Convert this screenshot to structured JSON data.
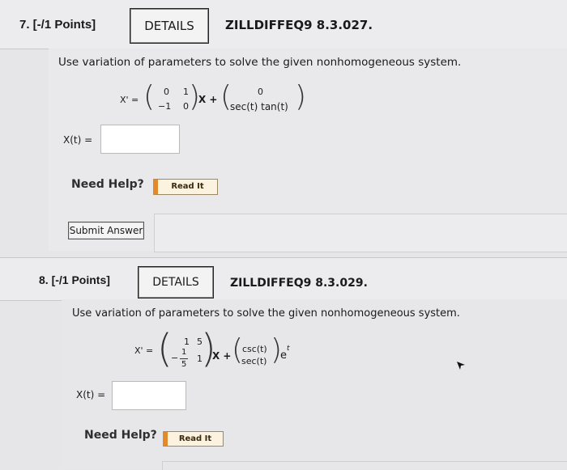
{
  "q7": {
    "number_points": "7.  [-/1 Points]",
    "details": "DETAILS",
    "code": "ZILLDIFFEQ9 8.3.027.",
    "prompt": "Use variation of parameters to solve the given nonhomogeneous system.",
    "lhs": "X' =",
    "matrix": [
      [
        "0",
        "1"
      ],
      [
        "−1",
        "0"
      ]
    ],
    "plus_x": "X +",
    "vector": [
      "0",
      "sec(t) tan(t)"
    ],
    "answer_label": "X(t) =",
    "answer_value": "",
    "need_help": "Need Help?",
    "read_it": "Read It",
    "submit": "Submit Answer"
  },
  "q8": {
    "number_points": "8.  [-/1 Points]",
    "details": "DETAILS",
    "code": "ZILLDIFFEQ9 8.3.029.",
    "prompt": "Use variation of parameters to solve the given nonhomogeneous system.",
    "lhs": "X' =",
    "matrix": {
      "r1c1": "1",
      "r1c2": "5",
      "r2c1_sign": "−",
      "r2c1_num": "1",
      "r2c1_den": "5",
      "r2c2": "1"
    },
    "plus_x": "X +",
    "vector": [
      "csc(t)",
      "sec(t)"
    ],
    "exp_base": "e",
    "exp_power": "t",
    "answer_label": "X(t) =",
    "answer_value": "",
    "need_help": "Need Help?",
    "read_it": "Read It"
  }
}
